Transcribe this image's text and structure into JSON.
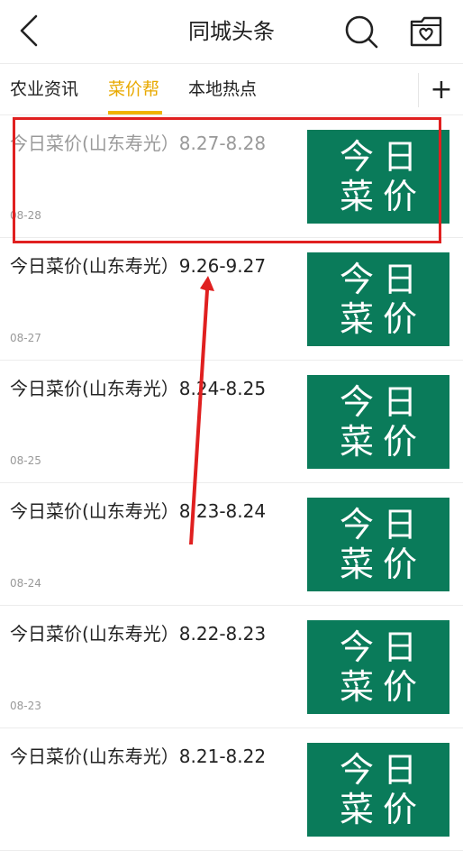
{
  "header": {
    "title": "同城头条",
    "back_icon": "chevron-left-icon",
    "search_icon": "search-icon",
    "favorites_icon": "heart-folder-icon"
  },
  "tabs": [
    {
      "label": "农业资讯",
      "active": false
    },
    {
      "label": "菜价帮",
      "active": true
    },
    {
      "label": "本地热点",
      "active": false
    }
  ],
  "add_tab_label": "+",
  "colors": {
    "accent": "#e8a900",
    "thumb_bg": "#0a7b5a",
    "highlight": "#e02020"
  },
  "thumb": {
    "line1": "今日",
    "line2": "菜价"
  },
  "articles": [
    {
      "title": "今日菜价(山东寿光）8.27-8.28",
      "date": "08-28"
    },
    {
      "title": "今日菜价(山东寿光）9.26-9.27",
      "date": "08-27"
    },
    {
      "title": "今日菜价(山东寿光）8.24-8.25",
      "date": "08-25"
    },
    {
      "title": "今日菜价(山东寿光）8.23-8.24",
      "date": "08-24"
    },
    {
      "title": "今日菜价(山东寿光）8.22-8.23",
      "date": "08-23"
    },
    {
      "title": "今日菜价(山东寿光）8.21-8.22",
      "date": ""
    }
  ]
}
